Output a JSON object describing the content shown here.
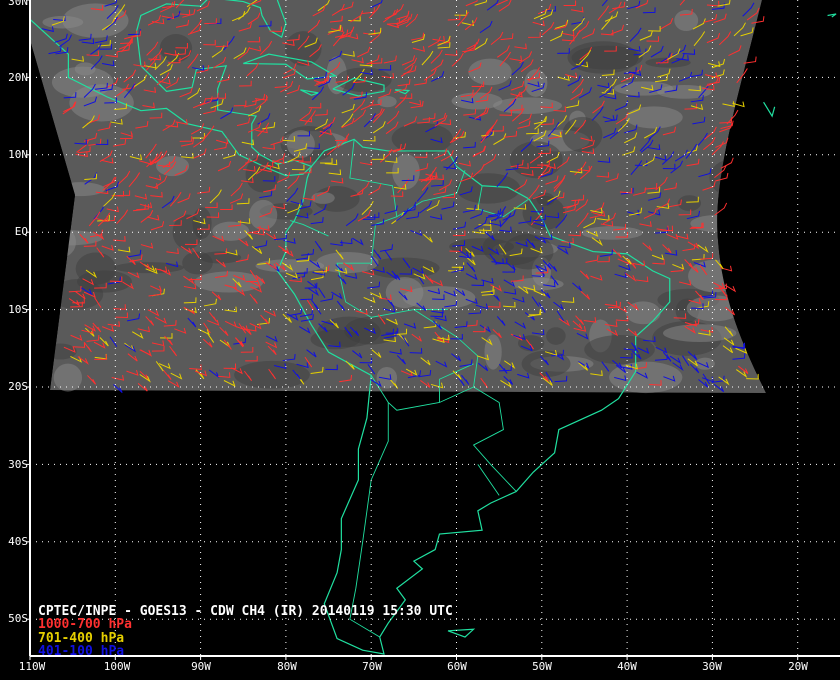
{
  "title": "CPTEC/INPE - GOES13 - CDW CH4 (IR) 20140119 15:30 UTC",
  "legend": [
    {
      "label": "1000-700 hPa",
      "color": "#ff3030"
    },
    {
      "label": "701-400 hPa",
      "color": "#e6d000"
    },
    {
      "label": "401-100 hPa",
      "color": "#1010e0"
    }
  ],
  "lat_labels": [
    "30N",
    "20N",
    "10N",
    "EQ",
    "10S",
    "20S",
    "30S",
    "40S",
    "50S"
  ],
  "lon_labels": [
    "110W",
    "100W",
    "90W",
    "80W",
    "70W",
    "60W",
    "50W",
    "40W",
    "30W",
    "20W"
  ],
  "colors": {
    "coast": "#20e0a0",
    "grid": "#ffffff",
    "background": "#000000"
  }
}
